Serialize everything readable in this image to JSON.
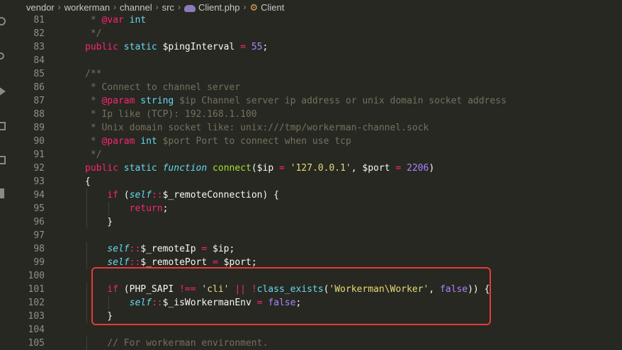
{
  "breadcrumb": {
    "items": [
      "vendor",
      "workerman",
      "channel",
      "src",
      "Client.php",
      "Client"
    ],
    "separator": "›"
  },
  "editor": {
    "lines": [
      {
        "n": "81",
        "t": [
          [
            "cm",
            " * "
          ],
          [
            "tag",
            "@var"
          ],
          [
            "st",
            " int"
          ]
        ]
      },
      {
        "n": "82",
        "t": [
          [
            "cm",
            " */"
          ]
        ]
      },
      {
        "n": "83",
        "t": [
          [
            "kw",
            "public"
          ],
          [
            "var",
            " "
          ],
          [
            "st",
            "static"
          ],
          [
            "var",
            " $pingInterval "
          ],
          [
            "op",
            "="
          ],
          [
            "var",
            " "
          ],
          [
            "num",
            "55"
          ],
          [
            "var",
            ";"
          ]
        ]
      },
      {
        "n": "84",
        "t": []
      },
      {
        "n": "85",
        "t": [
          [
            "cm",
            "/**"
          ]
        ]
      },
      {
        "n": "86",
        "t": [
          [
            "cm",
            " * Connect to channel server"
          ]
        ]
      },
      {
        "n": "87",
        "t": [
          [
            "cm",
            " * "
          ],
          [
            "tag",
            "@param"
          ],
          [
            "st",
            " string"
          ],
          [
            "cm",
            " $ip Channel server ip address or unix domain socket address"
          ]
        ]
      },
      {
        "n": "88",
        "t": [
          [
            "cm",
            " * Ip like (TCP): 192.168.1.100"
          ]
        ]
      },
      {
        "n": "89",
        "t": [
          [
            "cm",
            " * Unix domain socket like: unix:///tmp/workerman-channel.sock"
          ]
        ]
      },
      {
        "n": "90",
        "t": [
          [
            "cm",
            " * "
          ],
          [
            "tag",
            "@param"
          ],
          [
            "st",
            " int"
          ],
          [
            "cm",
            " $port Port to connect when use tcp"
          ]
        ]
      },
      {
        "n": "91",
        "t": [
          [
            "cm",
            " */"
          ]
        ]
      },
      {
        "n": "92",
        "t": [
          [
            "kw",
            "public"
          ],
          [
            "var",
            " "
          ],
          [
            "st",
            "static"
          ],
          [
            "var",
            " "
          ],
          [
            "it",
            "function"
          ],
          [
            "var",
            " "
          ],
          [
            "fn",
            "connect"
          ],
          [
            "var",
            "($ip "
          ],
          [
            "op",
            "="
          ],
          [
            "var",
            " "
          ],
          [
            "str",
            "'127.0.0.1'"
          ],
          [
            "var",
            ", $port "
          ],
          [
            "op",
            "="
          ],
          [
            "var",
            " "
          ],
          [
            "num",
            "2206"
          ],
          [
            "var",
            ")"
          ]
        ]
      },
      {
        "n": "93",
        "t": [
          [
            "var",
            "{"
          ]
        ]
      },
      {
        "n": "94",
        "t": [
          [
            "var",
            "    "
          ],
          [
            "kw",
            "if"
          ],
          [
            "var",
            " ("
          ],
          [
            "it",
            "self"
          ],
          [
            "op",
            "::"
          ],
          [
            "var",
            "$_remoteConnection) {"
          ]
        ]
      },
      {
        "n": "95",
        "t": [
          [
            "var",
            "        "
          ],
          [
            "kw",
            "return"
          ],
          [
            "var",
            ";"
          ]
        ]
      },
      {
        "n": "96",
        "t": [
          [
            "var",
            "    }"
          ]
        ]
      },
      {
        "n": "97",
        "t": []
      },
      {
        "n": "98",
        "t": [
          [
            "var",
            "    "
          ],
          [
            "it",
            "self"
          ],
          [
            "op",
            "::"
          ],
          [
            "var",
            "$_remoteIp "
          ],
          [
            "op",
            "="
          ],
          [
            "var",
            " $ip;"
          ]
        ]
      },
      {
        "n": "99",
        "t": [
          [
            "var",
            "    "
          ],
          [
            "it",
            "self"
          ],
          [
            "op",
            "::"
          ],
          [
            "var",
            "$_remotePort "
          ],
          [
            "op",
            "="
          ],
          [
            "var",
            " $port;"
          ]
        ]
      },
      {
        "n": "100",
        "t": []
      },
      {
        "n": "101",
        "t": [
          [
            "var",
            "    "
          ],
          [
            "kw",
            "if"
          ],
          [
            "var",
            " (PHP_SAPI "
          ],
          [
            "op",
            "!=="
          ],
          [
            "var",
            " "
          ],
          [
            "str",
            "'cli'"
          ],
          [
            "var",
            " "
          ],
          [
            "op",
            "||"
          ],
          [
            "var",
            " "
          ],
          [
            "op",
            "!"
          ],
          [
            "st",
            "class_exists"
          ],
          [
            "var",
            "("
          ],
          [
            "str",
            "'Workerman\\Worker'"
          ],
          [
            "var",
            ", "
          ],
          [
            "num",
            "false"
          ],
          [
            "var",
            ")) {"
          ]
        ]
      },
      {
        "n": "102",
        "t": [
          [
            "var",
            "        "
          ],
          [
            "it",
            "self"
          ],
          [
            "op",
            "::"
          ],
          [
            "var",
            "$_isWorkermanEnv "
          ],
          [
            "op",
            "="
          ],
          [
            "var",
            " "
          ],
          [
            "num",
            "false"
          ],
          [
            "var",
            ";"
          ]
        ]
      },
      {
        "n": "103",
        "t": [
          [
            "var",
            "    }"
          ]
        ]
      },
      {
        "n": "104",
        "t": []
      },
      {
        "n": "105",
        "t": [
          [
            "var",
            "    "
          ],
          [
            "cm",
            "// For workerman environment."
          ]
        ]
      }
    ]
  },
  "highlight": {
    "from_line": "101",
    "to_line": "103",
    "color": "#e53a3a"
  }
}
